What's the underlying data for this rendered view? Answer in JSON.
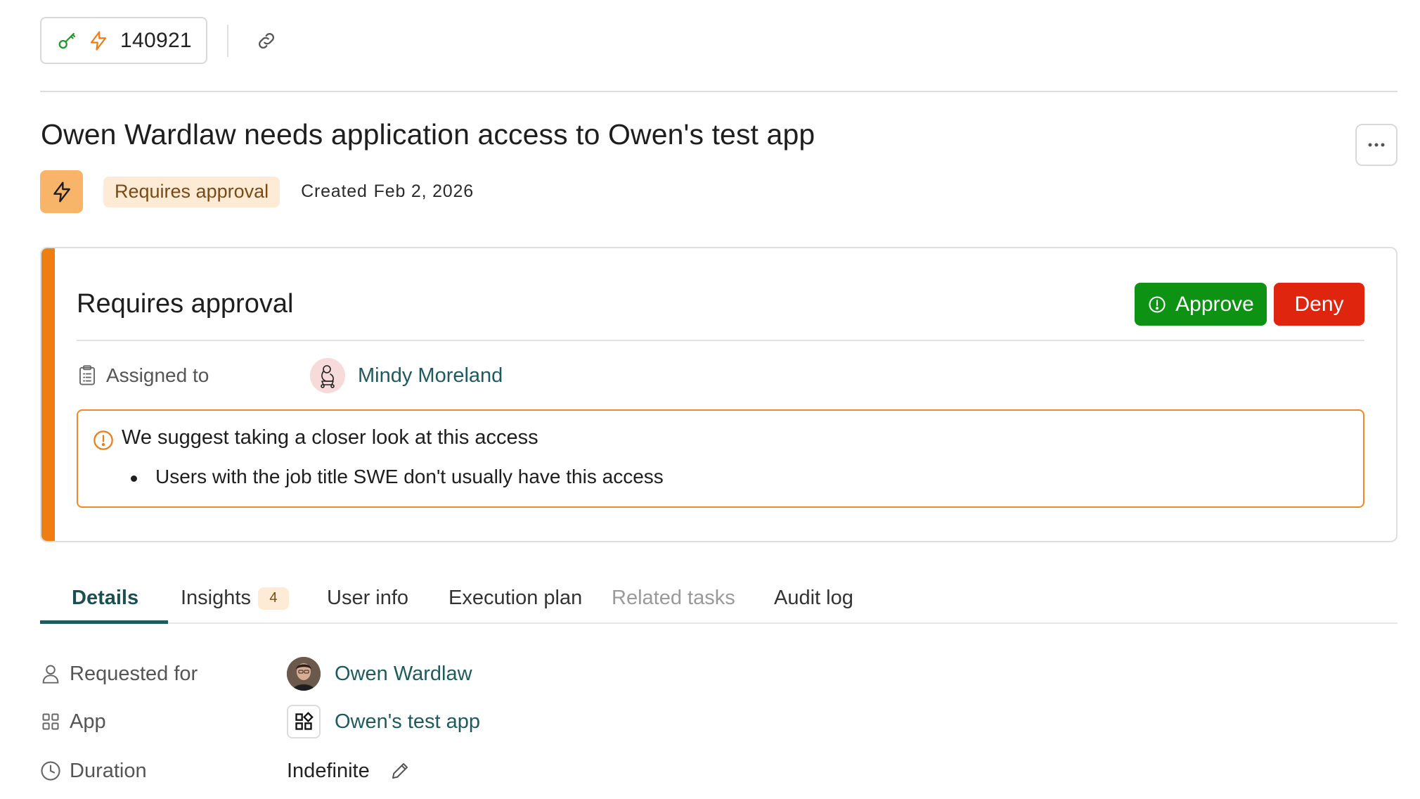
{
  "toolbar": {
    "ticket_number": "140921",
    "key_icon": "key-icon",
    "bolt_icon": "lightning-bolt-icon",
    "link_icon": "link-icon"
  },
  "header": {
    "title": "Owen Wardlaw needs application access to Owen's test app",
    "status_label": "Requires approval",
    "created_prefix": "Created",
    "created_date": "Feb 2, 2026",
    "more_icon": "more-horizontal-icon"
  },
  "approval": {
    "title": "Requires approval",
    "approve_label": "Approve",
    "deny_label": "Deny",
    "assigned_label": "Assigned to",
    "assignee_name": "Mindy Moreland",
    "suggestion_headline": "We suggest taking a closer look at this access",
    "suggestion_items": [
      "Users with the job title SWE don't usually have this access"
    ]
  },
  "tabs": [
    {
      "label": "Details",
      "active": true
    },
    {
      "label": "Insights",
      "badge": "4"
    },
    {
      "label": "User info"
    },
    {
      "label": "Execution plan"
    },
    {
      "label": "Related tasks",
      "disabled": true
    },
    {
      "label": "Audit log"
    }
  ],
  "details": {
    "requested_for_label": "Requested for",
    "requested_for_value": "Owen Wardlaw",
    "app_label": "App",
    "app_value": "Owen's test app",
    "duration_label": "Duration",
    "duration_value": "Indefinite"
  },
  "colors": {
    "accent_orange": "#ef7e12",
    "approve_green": "#0d9213",
    "deny_red": "#e0250f",
    "link_teal": "#1d5b5e",
    "status_pill_bg": "#fdebd6"
  }
}
